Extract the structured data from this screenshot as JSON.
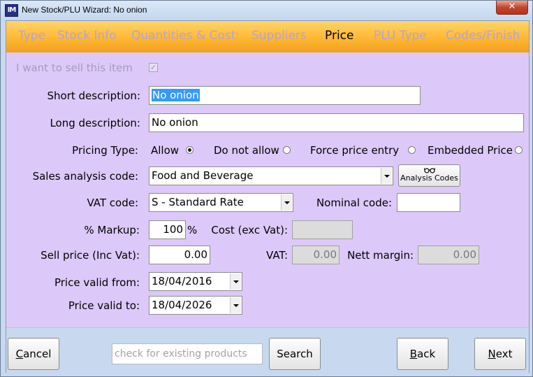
{
  "window": {
    "title": "New Stock/PLU Wizard: No onion",
    "app_icon_text": "IM",
    "close_glyph": "✕"
  },
  "tabs": [
    {
      "label": "Type",
      "active": false
    },
    {
      "label": "Stock Info",
      "active": false
    },
    {
      "label": "Quantities & Cost",
      "active": false
    },
    {
      "label": "Suppliers",
      "active": false
    },
    {
      "label": "Price",
      "active": true
    },
    {
      "label": "PLU Type",
      "active": false
    },
    {
      "label": "Codes/Finish",
      "active": false
    }
  ],
  "form": {
    "sell_item": {
      "label": "I want to sell this item",
      "checked": true,
      "check_glyph": "✓"
    },
    "short_description": {
      "label": "Short description:",
      "value": "No onion"
    },
    "long_description": {
      "label": "Long description:",
      "value": "No onion"
    },
    "pricing_type": {
      "label": "Pricing Type:",
      "options": [
        {
          "label": "Allow",
          "checked": true
        },
        {
          "label": "Do not allow",
          "checked": false
        },
        {
          "label": "Force price entry",
          "checked": false
        },
        {
          "label": "Embedded Price",
          "checked": false
        }
      ]
    },
    "sales_analysis": {
      "label": "Sales analysis code:",
      "value": "Food and Beverage",
      "button_label": "Analysis Codes",
      "button_icon": "glasses-icon"
    },
    "vat_code": {
      "label": "VAT code:",
      "value": "S - Standard Rate"
    },
    "nominal_code": {
      "label": "Nominal code:",
      "value": ""
    },
    "markup": {
      "label": "% Markup:",
      "value": "100",
      "unit": "%"
    },
    "cost": {
      "label": "Cost (exc Vat):",
      "value": ""
    },
    "sell_price": {
      "label": "Sell price (Inc Vat):",
      "value": "0.00"
    },
    "vat": {
      "label": "VAT:",
      "value": "0.00"
    },
    "nett_margin": {
      "label": "Nett margin:",
      "value": "0.00"
    },
    "valid_from": {
      "label": "Price valid from:",
      "value": "18/04/2016"
    },
    "valid_to": {
      "label": "Price valid to:",
      "value": "18/04/2026"
    }
  },
  "footer": {
    "cancel": {
      "pre": "",
      "accel": "C",
      "post": "ancel"
    },
    "search_placeholder": "check for existing products",
    "search_label": "Search",
    "back": {
      "pre": "",
      "accel": "B",
      "post": "ack"
    },
    "next": {
      "pre": "",
      "accel": "N",
      "post": "ext"
    }
  },
  "colors": {
    "tab_active": "#000000",
    "tab_inactive": "#b4a4d2",
    "form_background": "#dcc9f9",
    "tab_bar": "#ffb833",
    "selection": "#3399ff"
  }
}
